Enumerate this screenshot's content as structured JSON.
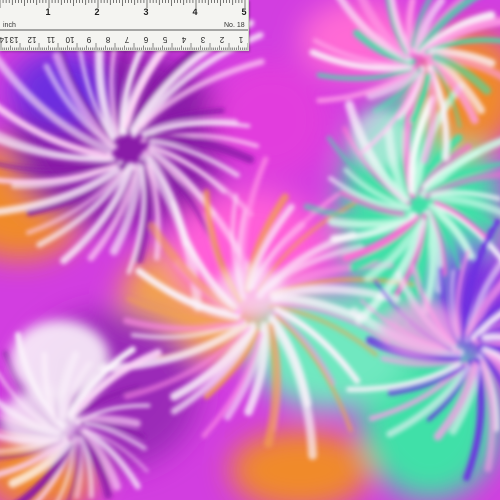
{
  "ruler": {
    "unit_label": "inch",
    "number_label": "No. 18",
    "inch_numbers": [
      "1",
      "2",
      "3",
      "4",
      "5"
    ],
    "cm_numbers": [
      "1",
      "2",
      "3",
      "4",
      "5",
      "6",
      "7",
      "8",
      "9",
      "10",
      "11",
      "12",
      "13",
      "14"
    ]
  },
  "fabric": {
    "pattern": "tie-dye spirals",
    "colors": {
      "magenta": "#e23ddd",
      "purple": "#8a1aa8",
      "violet": "#6d2fe0",
      "orange": "#f08a2c",
      "mint": "#3fe0a8",
      "teal": "#33c9c9",
      "white": "#fbf2fb",
      "pink": "#ff6ad5"
    }
  }
}
